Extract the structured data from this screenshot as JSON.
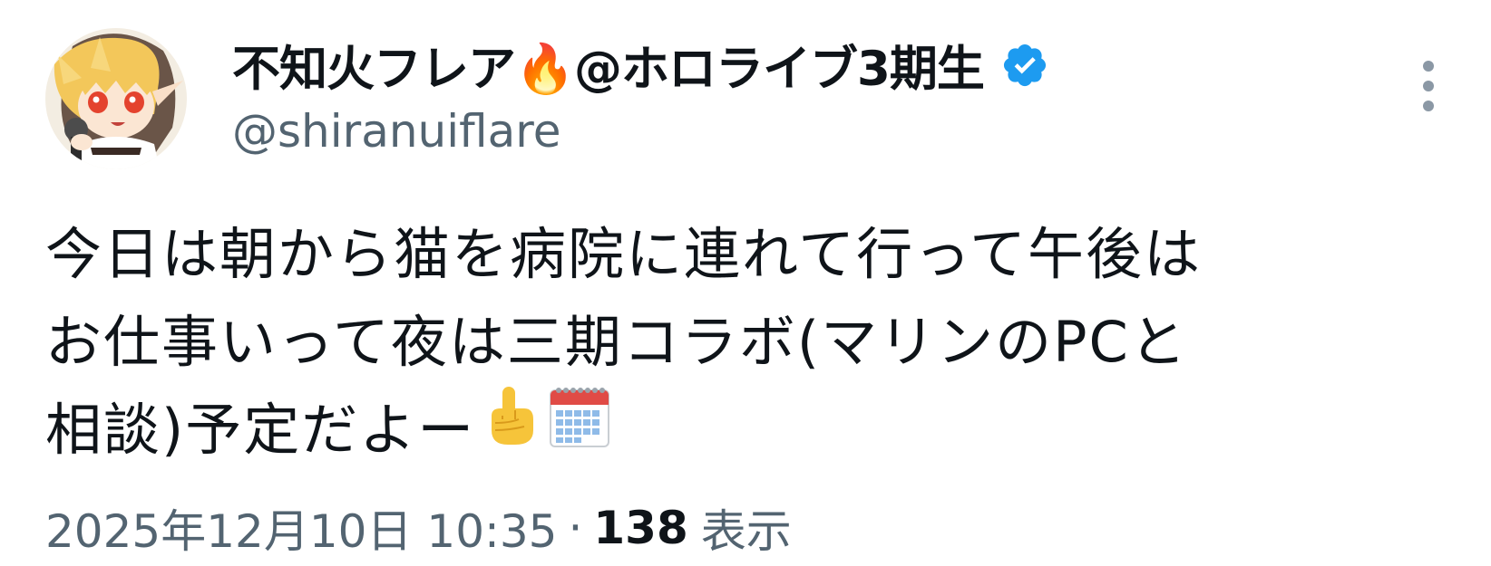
{
  "tweet": {
    "author": {
      "display_name": "不知火フレア🔥@ホロライブ3期生",
      "username": "@shiranuiflare",
      "verified": true,
      "avatar_icon": "anime-character-avatar"
    },
    "text_lines": [
      "今日は朝から猫を病院に連れて行って午後は",
      "お仕事いって夜は三期コラボ(マリンのPCと",
      "相談)予定だよー"
    ],
    "trailing_emojis": [
      "point-up-icon",
      "calendar-icon"
    ],
    "timestamp": "2025年12月10日 10:35",
    "separator": "·",
    "views_count": "138",
    "views_label": "表示"
  },
  "colors": {
    "text_primary": "#0f1419",
    "text_secondary": "#536471",
    "verified_blue": "#1d9bf0",
    "more_dots": "#8b98a5"
  }
}
